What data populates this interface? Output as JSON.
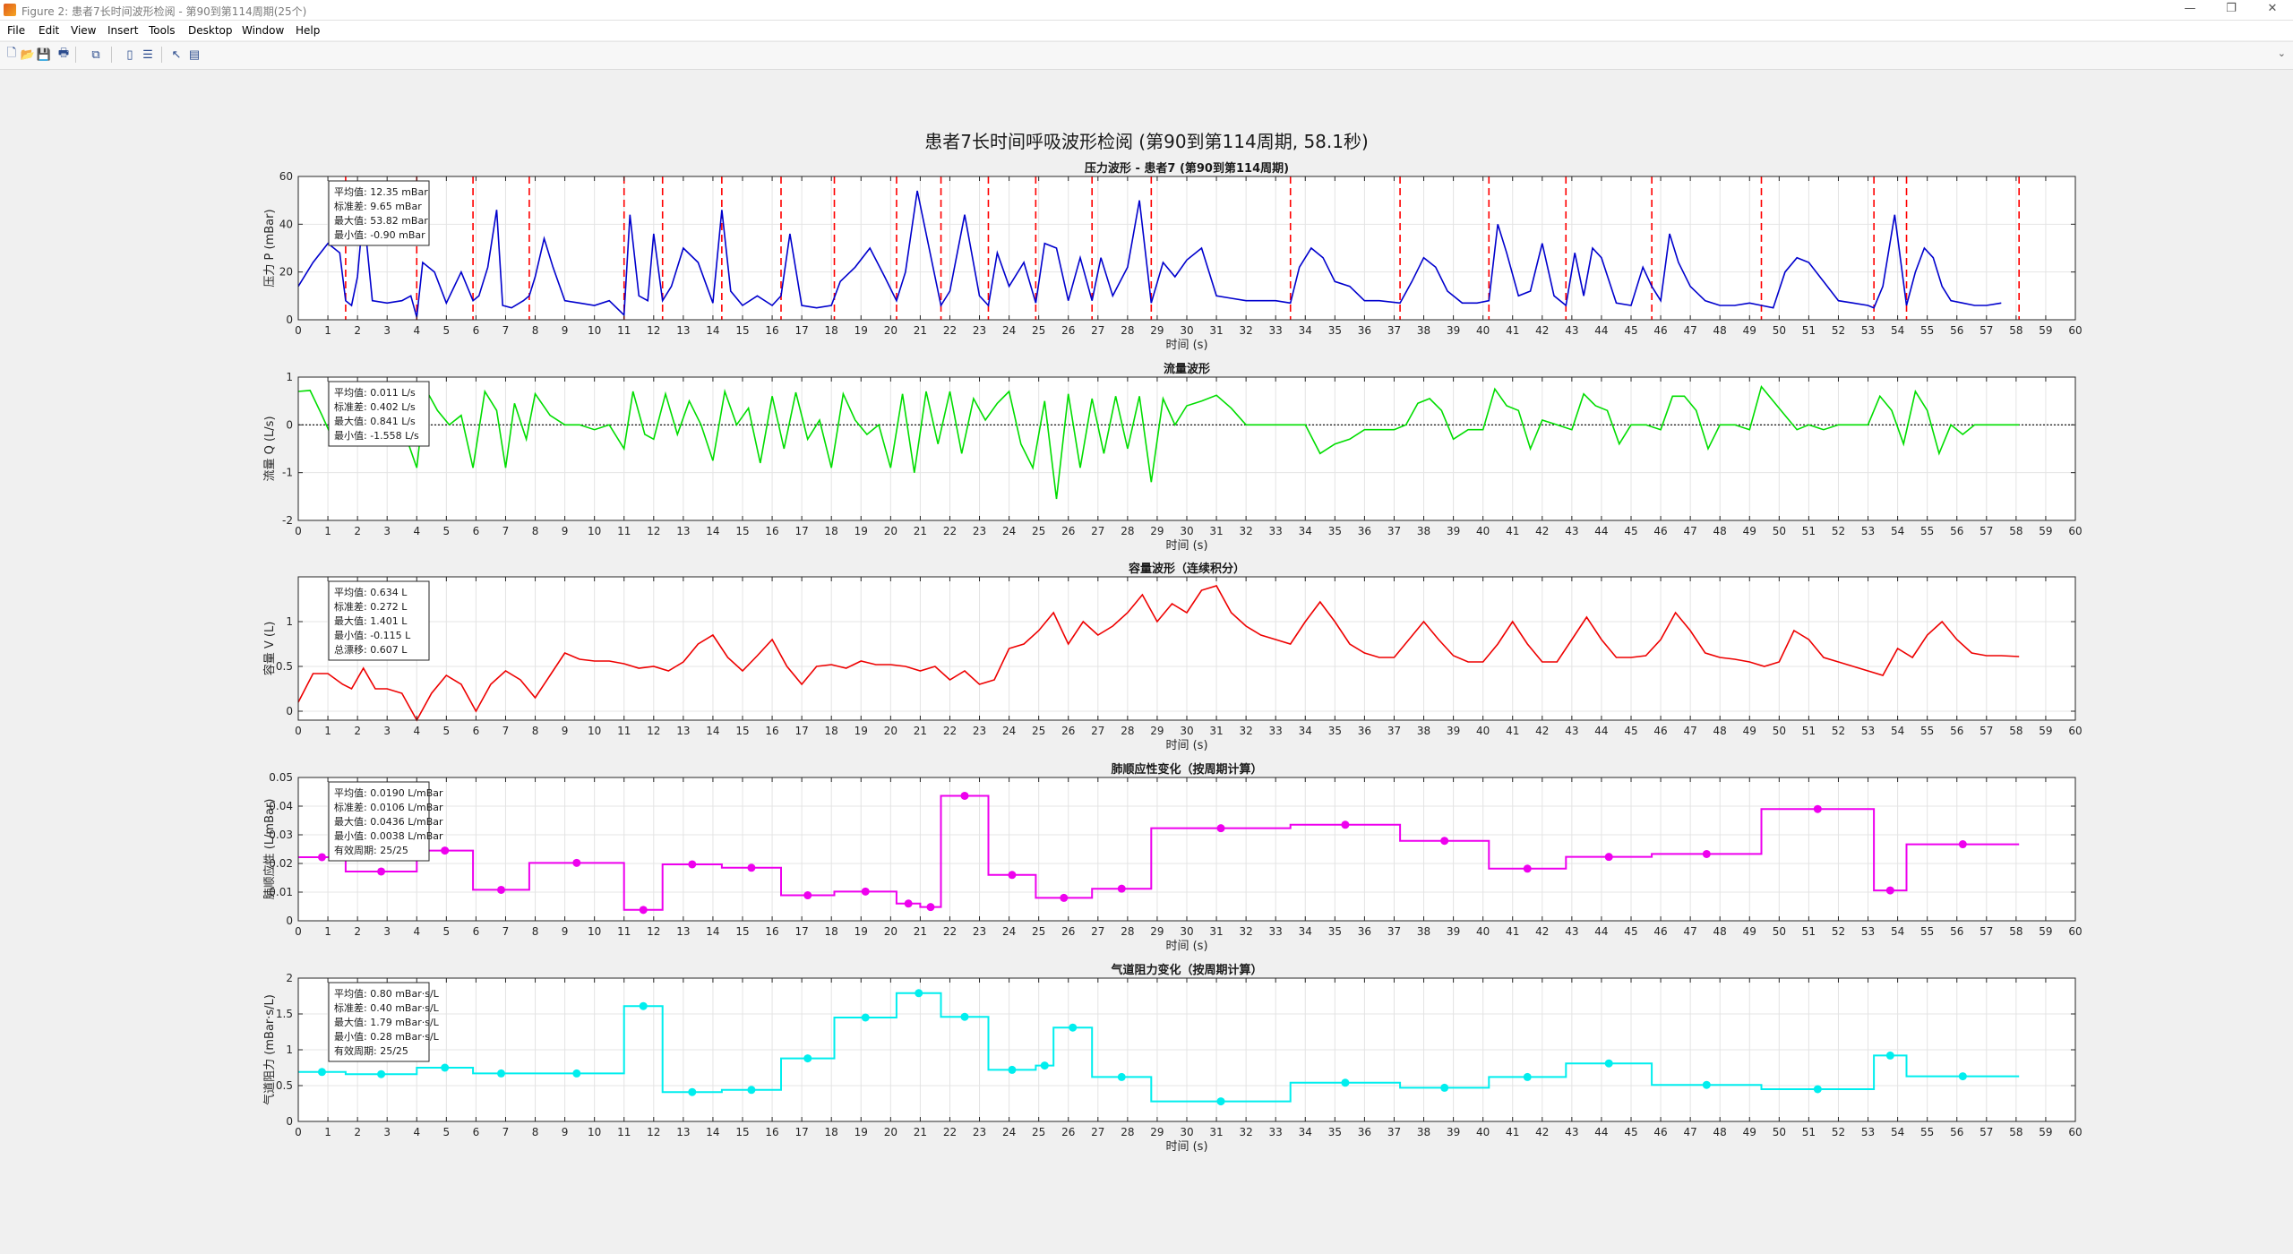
{
  "window": {
    "title": "Figure 2: 患者7长时间波形检阅 - 第90到第114周期(25个)",
    "controls": [
      "—",
      "❐",
      "✕"
    ]
  },
  "menubar": [
    "File",
    "Edit",
    "View",
    "Insert",
    "Tools",
    "Desktop",
    "Window",
    "Help"
  ],
  "toolbar": {
    "tools": [
      {
        "name": "new-figure-icon",
        "glyph": "🗋"
      },
      {
        "name": "open-file-icon",
        "glyph": "📂"
      },
      {
        "name": "save-icon",
        "glyph": "💾"
      },
      {
        "name": "print-icon",
        "glyph": "🖶"
      },
      {
        "name": "link-plot-icon",
        "glyph": "⧉"
      },
      {
        "name": "insert-colorbar-icon",
        "glyph": "▯"
      },
      {
        "name": "insert-legend-icon",
        "glyph": "☰"
      },
      {
        "name": "edit-plot-icon",
        "glyph": "↖"
      },
      {
        "name": "property-inspector-icon",
        "glyph": "▤"
      }
    ],
    "chevron": "⌄"
  },
  "figure": {
    "suptitle": "患者7长时间呼吸波形检阅 (第90到第114周期, 58.1秒)"
  },
  "chart_data": [
    {
      "type": "line",
      "title": "压力波形 - 患者7 (第90到第114周期)",
      "xlabel": "时间 (s)",
      "ylabel": "压力 P (mBar)",
      "xlim": [
        0,
        60
      ],
      "ylim": [
        0,
        60
      ],
      "yticks": [
        0,
        20,
        40,
        60
      ],
      "grid": true,
      "color": "#0000cd",
      "stats": [
        "平均值: 12.35 mBar",
        "标准差: 9.65 mBar",
        "最大值: 53.82 mBar",
        "最小值: -0.90 mBar"
      ],
      "cycle_boundaries": [
        1.6,
        4.0,
        5.9,
        7.8,
        11.0,
        12.3,
        14.3,
        16.3,
        18.1,
        20.2,
        21.7,
        23.3,
        24.9,
        26.8,
        28.8,
        33.5,
        37.2,
        40.2,
        42.8,
        45.7,
        49.4,
        53.2,
        54.3,
        58.1
      ],
      "x": [
        0,
        0.5,
        1.0,
        1.4,
        1.6,
        1.8,
        2.0,
        2.2,
        2.5,
        3.0,
        3.5,
        3.8,
        4.0,
        4.2,
        4.6,
        5.0,
        5.5,
        5.9,
        6.1,
        6.4,
        6.7,
        6.9,
        7.2,
        7.6,
        7.8,
        8.0,
        8.3,
        8.6,
        9.0,
        9.5,
        10.0,
        10.5,
        11.0,
        11.2,
        11.5,
        11.8,
        12.0,
        12.3,
        12.6,
        13.0,
        13.5,
        14.0,
        14.3,
        14.6,
        15.0,
        15.5,
        16.0,
        16.3,
        16.6,
        17.0,
        17.5,
        18.0,
        18.3,
        18.8,
        19.3,
        19.8,
        20.2,
        20.5,
        20.9,
        21.3,
        21.7,
        22.0,
        22.5,
        23.0,
        23.3,
        23.6,
        24.0,
        24.5,
        24.9,
        25.2,
        25.6,
        26.0,
        26.4,
        26.8,
        27.1,
        27.5,
        28.0,
        28.4,
        28.8,
        29.2,
        29.6,
        30.0,
        30.5,
        31.0,
        31.5,
        32.0,
        32.5,
        33.0,
        33.5,
        33.8,
        34.2,
        34.6,
        35.0,
        35.5,
        36.0,
        36.5,
        37.2,
        37.6,
        38.0,
        38.4,
        38.8,
        39.3,
        39.8,
        40.2,
        40.5,
        40.8,
        41.2,
        41.6,
        42.0,
        42.4,
        42.8,
        43.1,
        43.4,
        43.7,
        44.0,
        44.5,
        45.0,
        45.4,
        45.7,
        46.0,
        46.3,
        46.6,
        47.0,
        47.5,
        48.0,
        48.5,
        49.0,
        49.4,
        49.8,
        50.2,
        50.6,
        51.0,
        51.5,
        52.0,
        52.5,
        53.0,
        53.2,
        53.5,
        53.9,
        54.3,
        54.6,
        54.9,
        55.2,
        55.5,
        55.8,
        56.2,
        56.6,
        57.0,
        57.5,
        58.1
      ],
      "y": [
        14,
        24,
        32,
        28,
        8,
        6,
        18,
        46,
        8,
        7,
        8,
        10,
        1,
        24,
        20,
        7,
        20,
        8,
        10,
        22,
        46,
        6,
        5,
        8,
        10,
        18,
        34,
        22,
        8,
        7,
        6,
        8,
        2,
        44,
        10,
        8,
        36,
        8,
        14,
        30,
        24,
        7,
        46,
        12,
        6,
        10,
        6,
        10,
        36,
        6,
        5,
        6,
        16,
        22,
        30,
        18,
        8,
        20,
        54,
        30,
        6,
        12,
        44,
        10,
        6,
        28,
        14,
        24,
        7,
        32,
        30,
        8,
        26,
        8,
        26,
        10,
        22,
        50,
        7,
        24,
        18,
        25,
        30,
        10,
        9,
        8,
        8,
        8,
        7,
        22,
        30,
        26,
        16,
        14,
        8,
        8,
        7,
        16,
        26,
        22,
        12,
        7,
        7,
        8,
        40,
        28,
        10,
        12,
        32,
        10,
        6,
        28,
        10,
        30,
        26,
        7,
        6,
        22,
        14,
        8,
        36,
        24,
        14,
        8,
        6,
        6,
        7,
        6,
        5,
        20,
        26,
        24,
        16,
        8,
        7,
        6,
        5,
        14,
        44,
        6,
        20,
        30,
        26,
        14,
        8,
        7,
        6,
        6,
        7
      ]
    },
    {
      "type": "line",
      "title": "流量波形",
      "xlabel": "时间 (s)",
      "ylabel": "流量 Q (L/s)",
      "xlim": [
        0,
        60
      ],
      "ylim": [
        -2,
        1
      ],
      "yticks": [
        -2,
        -1,
        0,
        1
      ],
      "grid": true,
      "zero_line": true,
      "color": "#00dd00",
      "stats": [
        "平均值: 0.011 L/s",
        "标准差: 0.402 L/s",
        "最大值: 0.841 L/s",
        "最小值: -1.558 L/s"
      ],
      "x": [
        0,
        0.4,
        0.8,
        1.2,
        1.6,
        1.9,
        2.2,
        2.6,
        3.0,
        3.5,
        4.0,
        4.3,
        4.7,
        5.1,
        5.5,
        5.9,
        6.3,
        6.7,
        7.0,
        7.3,
        7.7,
        8.0,
        8.5,
        9.0,
        9.5,
        10.0,
        10.5,
        11.0,
        11.3,
        11.7,
        12.0,
        12.4,
        12.8,
        13.2,
        13.6,
        14.0,
        14.4,
        14.8,
        15.2,
        15.6,
        16.0,
        16.4,
        16.8,
        17.2,
        17.6,
        18.0,
        18.4,
        18.8,
        19.2,
        19.6,
        20.0,
        20.4,
        20.8,
        21.2,
        21.6,
        22.0,
        22.4,
        22.8,
        23.2,
        23.6,
        24.0,
        24.4,
        24.8,
        25.2,
        25.6,
        26.0,
        26.4,
        26.8,
        27.2,
        27.6,
        28.0,
        28.4,
        28.8,
        29.2,
        29.6,
        30.0,
        30.5,
        31.0,
        31.5,
        32.0,
        32.5,
        33.0,
        33.5,
        34.0,
        34.5,
        35.0,
        35.5,
        36.0,
        36.5,
        37.0,
        37.4,
        37.8,
        38.2,
        38.6,
        39.0,
        39.5,
        40.0,
        40.4,
        40.8,
        41.2,
        41.6,
        42.0,
        42.5,
        43.0,
        43.4,
        43.8,
        44.2,
        44.6,
        45.0,
        45.5,
        46.0,
        46.4,
        46.8,
        47.2,
        47.6,
        48.0,
        48.5,
        49.0,
        49.4,
        49.8,
        50.2,
        50.6,
        51.0,
        51.5,
        52.0,
        52.5,
        53.0,
        53.4,
        53.8,
        54.2,
        54.6,
        55.0,
        55.4,
        55.8,
        56.2,
        56.6,
        57.0,
        57.5,
        58.1
      ],
      "y": [
        0.7,
        0.72,
        0.2,
        -0.35,
        -0.1,
        0.78,
        -0.4,
        -0.1,
        -0.1,
        0.0,
        -0.9,
        0.75,
        0.3,
        0.0,
        0.2,
        -0.9,
        0.7,
        0.3,
        -0.9,
        0.45,
        -0.3,
        0.65,
        0.2,
        0.0,
        0.0,
        -0.1,
        0.0,
        -0.5,
        0.7,
        -0.2,
        -0.3,
        0.65,
        -0.2,
        0.5,
        0.0,
        -0.75,
        0.7,
        0.0,
        0.35,
        -0.8,
        0.6,
        -0.5,
        0.68,
        -0.3,
        0.1,
        -0.9,
        0.65,
        0.1,
        -0.2,
        0.0,
        -0.9,
        0.65,
        -1.0,
        0.7,
        -0.4,
        0.7,
        -0.6,
        0.55,
        0.1,
        0.45,
        0.7,
        -0.4,
        -0.9,
        0.5,
        -1.55,
        0.65,
        -0.9,
        0.55,
        -0.6,
        0.6,
        -0.5,
        0.6,
        -1.2,
        0.55,
        0.0,
        0.4,
        0.5,
        0.62,
        0.35,
        0.0,
        0.0,
        0.0,
        0.0,
        0.0,
        -0.6,
        -0.4,
        -0.3,
        -0.1,
        -0.1,
        -0.1,
        0.0,
        0.45,
        0.55,
        0.3,
        -0.3,
        -0.1,
        -0.1,
        0.75,
        0.4,
        0.3,
        -0.5,
        0.1,
        0.0,
        -0.1,
        0.65,
        0.4,
        0.3,
        -0.4,
        0.0,
        0.0,
        -0.1,
        0.6,
        0.6,
        0.3,
        -0.5,
        0.0,
        0.0,
        -0.1,
        0.8,
        0.5,
        0.2,
        -0.1,
        0.0,
        -0.1,
        0.0,
        0.0,
        0.0,
        0.6,
        0.3,
        -0.4,
        0.7,
        0.3,
        -0.6,
        0.0,
        -0.2,
        0.0,
        0.0,
        0.0,
        0.0
      ]
    },
    {
      "type": "line",
      "title": "容量波形（连续积分）",
      "xlabel": "时间 (s)",
      "ylabel": "容量 V (L)",
      "xlim": [
        0,
        60
      ],
      "ylim": [
        -0.1,
        1.5
      ],
      "yticks": [
        0,
        0.5,
        1
      ],
      "grid": true,
      "color": "#ee0000",
      "stats": [
        "平均值: 0.634 L",
        "标准差: 0.272 L",
        "最大值: 1.401 L",
        "最小值: -0.115 L",
        "总漂移: 0.607 L"
      ],
      "x": [
        0,
        0.5,
        1.0,
        1.5,
        1.8,
        2.2,
        2.6,
        3.0,
        3.5,
        4.0,
        4.5,
        5.0,
        5.5,
        6.0,
        6.5,
        7.0,
        7.5,
        8.0,
        8.5,
        9.0,
        9.5,
        10.0,
        10.5,
        11.0,
        11.5,
        12.0,
        12.5,
        13.0,
        13.5,
        14.0,
        14.5,
        15.0,
        15.5,
        16.0,
        16.5,
        17.0,
        17.5,
        18.0,
        18.5,
        19.0,
        19.5,
        20.0,
        20.5,
        21.0,
        21.5,
        22.0,
        22.5,
        23.0,
        23.5,
        24.0,
        24.5,
        25.0,
        25.5,
        26.0,
        26.5,
        27.0,
        27.5,
        28.0,
        28.5,
        29.0,
        29.5,
        30.0,
        30.5,
        31.0,
        31.5,
        32.0,
        32.5,
        33.0,
        33.5,
        34.0,
        34.5,
        35.0,
        35.5,
        36.0,
        36.5,
        37.0,
        37.5,
        38.0,
        38.5,
        39.0,
        39.5,
        40.0,
        40.5,
        41.0,
        41.5,
        42.0,
        42.5,
        43.0,
        43.5,
        44.0,
        44.5,
        45.0,
        45.5,
        46.0,
        46.5,
        47.0,
        47.5,
        48.0,
        48.5,
        49.0,
        49.5,
        50.0,
        50.5,
        51.0,
        51.5,
        52.0,
        52.5,
        53.0,
        53.5,
        54.0,
        54.5,
        55.0,
        55.5,
        56.0,
        56.5,
        57.0,
        57.5,
        58.1
      ],
      "y": [
        0.1,
        0.42,
        0.42,
        0.3,
        0.25,
        0.48,
        0.25,
        0.25,
        0.2,
        -0.1,
        0.2,
        0.4,
        0.3,
        0.0,
        0.3,
        0.45,
        0.35,
        0.15,
        0.4,
        0.65,
        0.58,
        0.56,
        0.56,
        0.53,
        0.48,
        0.5,
        0.45,
        0.55,
        0.75,
        0.85,
        0.6,
        0.45,
        0.62,
        0.8,
        0.5,
        0.3,
        0.5,
        0.52,
        0.48,
        0.56,
        0.52,
        0.52,
        0.5,
        0.45,
        0.5,
        0.35,
        0.45,
        0.3,
        0.35,
        0.7,
        0.75,
        0.9,
        1.1,
        0.75,
        1.0,
        0.85,
        0.95,
        1.1,
        1.3,
        1.0,
        1.2,
        1.1,
        1.35,
        1.4,
        1.1,
        0.95,
        0.85,
        0.8,
        0.75,
        1.0,
        1.22,
        1.0,
        0.75,
        0.65,
        0.6,
        0.6,
        0.8,
        1.0,
        0.8,
        0.62,
        0.55,
        0.55,
        0.75,
        1.0,
        0.75,
        0.55,
        0.55,
        0.8,
        1.05,
        0.8,
        0.6,
        0.6,
        0.62,
        0.8,
        1.1,
        0.9,
        0.65,
        0.6,
        0.58,
        0.55,
        0.5,
        0.55,
        0.9,
        0.8,
        0.6,
        0.55,
        0.5,
        0.45,
        0.4,
        0.7,
        0.6,
        0.85,
        1.0,
        0.8,
        0.65,
        0.62,
        0.62,
        0.61
      ]
    },
    {
      "type": "line",
      "title": "肺顺应性变化（按周期计算）",
      "xlabel": "时间 (s)",
      "ylabel": "肺顺应性 (L/mBar)",
      "xlim": [
        0,
        60
      ],
      "ylim": [
        0,
        0.05
      ],
      "yticks": [
        0,
        0.01,
        0.02,
        0.03,
        0.04,
        0.05
      ],
      "grid": true,
      "color": "#ee00ee",
      "stats": [
        "平均值: 0.0190 L/mBar",
        "标准差: 0.0106 L/mBar",
        "最大值: 0.0436 L/mBar",
        "最小值: 0.0038 L/mBar",
        "有效周期: 25/25"
      ],
      "x": [
        0,
        1.6,
        4.0,
        5.9,
        7.8,
        11.0,
        12.3,
        14.3,
        16.3,
        18.1,
        20.2,
        21.0,
        21.7,
        23.3,
        24.9,
        26.8,
        28.8,
        33.5,
        37.2,
        40.2,
        42.8,
        45.7,
        49.4,
        53.2,
        54.3,
        58.1
      ],
      "y": [
        0.0222,
        0.0172,
        0.0245,
        0.0108,
        0.0202,
        0.0038,
        0.0197,
        0.0185,
        0.0089,
        0.0102,
        0.006,
        0.0048,
        0.0436,
        0.016,
        0.008,
        0.0112,
        0.0323,
        0.0335,
        0.0279,
        0.0182,
        0.0223,
        0.0233,
        0.039,
        0.0106,
        0.0267
      ]
    },
    {
      "type": "line",
      "title": "气道阻力变化（按周期计算）",
      "xlabel": "时间 (s)",
      "ylabel": "气道阻力 (mBar·s/L)",
      "xlim": [
        0,
        60
      ],
      "ylim": [
        0,
        2
      ],
      "yticks": [
        0,
        0.5,
        1,
        1.5,
        2
      ],
      "grid": true,
      "color": "#00eeee",
      "stats": [
        "平均值: 0.80 mBar·s/L",
        "标准差: 0.40 mBar·s/L",
        "最大值: 1.79 mBar·s/L",
        "最小值: 0.28 mBar·s/L",
        "有效周期: 25/25"
      ],
      "x": [
        0,
        1.6,
        4.0,
        5.9,
        7.8,
        11.0,
        12.3,
        14.3,
        16.3,
        18.1,
        20.2,
        21.7,
        23.3,
        24.9,
        25.5,
        26.8,
        28.8,
        33.5,
        37.2,
        40.2,
        42.8,
        45.7,
        49.4,
        53.2,
        54.3,
        58.1
      ],
      "y": [
        0.69,
        0.66,
        0.75,
        0.67,
        0.67,
        1.61,
        0.41,
        0.44,
        0.88,
        1.45,
        1.79,
        1.46,
        0.72,
        0.78,
        1.31,
        0.62,
        0.28,
        0.54,
        0.47,
        0.62,
        0.81,
        0.51,
        0.45,
        0.92,
        0.63
      ]
    }
  ]
}
